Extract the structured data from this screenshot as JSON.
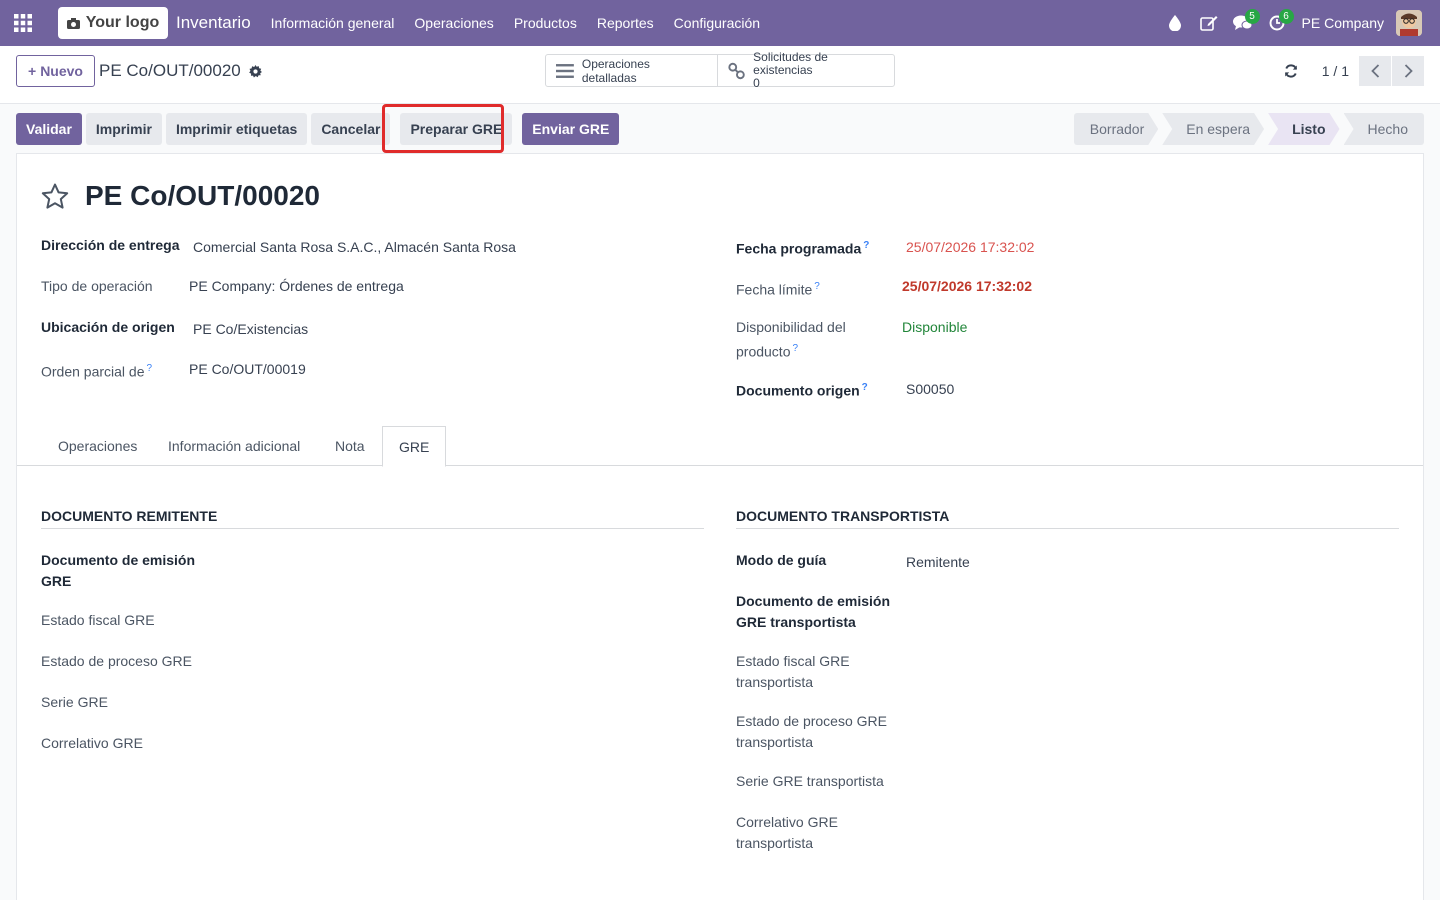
{
  "navbar": {
    "logo_text": "Your logo",
    "app_name": "Inventario",
    "menu": [
      "Información general",
      "Operaciones",
      "Productos",
      "Reportes",
      "Configuración"
    ],
    "messages_badge": "5",
    "activities_badge": "6",
    "company": "PE Company"
  },
  "control": {
    "new_label": "Nuevo",
    "record_name": "PE Co/OUT/00020",
    "smart_buttons": {
      "detailed_ops": "Operaciones detalladas",
      "stock_requests_label": "Solicitudes de existencias",
      "stock_requests_count": "0"
    },
    "pager": "1 / 1"
  },
  "actions": {
    "validate": "Validar",
    "print": "Imprimir",
    "print_labels": "Imprimir etiquetas",
    "cancel": "Cancelar",
    "prepare_gre": "Preparar GRE",
    "send_gre": "Enviar GRE"
  },
  "stages": [
    "Borrador",
    "En espera",
    "Listo",
    "Hecho"
  ],
  "active_stage": "Listo",
  "form": {
    "title": "PE Co/OUT/00020",
    "delivery_address_label": "Dirección de entrega",
    "delivery_address": "Comercial Santa Rosa S.A.C., Almacén Santa Rosa",
    "operation_type_label": "Tipo de operación",
    "operation_type": "PE Company: Órdenes de entrega",
    "source_location_label": "Ubicación de origen",
    "source_location": "PE Co/Existencias",
    "backorder_label": "Orden parcial de",
    "backorder": "PE Co/OUT/00019",
    "scheduled_date_label": "Fecha programada",
    "scheduled_date": "25/07/2026 17:32:02",
    "deadline_label": "Fecha límite",
    "deadline": "25/07/2026 17:32:02",
    "availability_label_1": "Disponibilidad del",
    "availability_label_2": "producto",
    "availability": "Disponible",
    "source_doc_label": "Documento origen",
    "source_doc": "S00050"
  },
  "tabs": [
    "Operaciones",
    "Información adicional",
    "Nota",
    "GRE"
  ],
  "active_tab": "GRE",
  "gre": {
    "sender_title": "DOCUMENTO REMITENTE",
    "sender_fields": {
      "doc_emision_1": "Documento de emisión",
      "doc_emision_2": "GRE",
      "estado_fiscal": "Estado fiscal GRE",
      "estado_proceso": "Estado de proceso GRE",
      "serie": "Serie GRE",
      "correlativo": "Correlativo GRE"
    },
    "carrier_title": "DOCUMENTO TRANSPORTISTA",
    "carrier_fields": {
      "modo_guia_label": "Modo de guía",
      "modo_guia": "Remitente",
      "doc_emision_1": "Documento de emisión",
      "doc_emision_2": "GRE transportista",
      "estado_fiscal_1": "Estado fiscal GRE",
      "estado_fiscal_2": "transportista",
      "estado_proceso_1": "Estado de proceso GRE",
      "estado_proceso_2": "transportista",
      "serie": "Serie GRE transportista",
      "correlativo_1": "Correlativo GRE",
      "correlativo_2": "transportista"
    }
  },
  "colors": {
    "brand": "#71639e",
    "highlight": "#e02b2b",
    "deadline": "#c0392b",
    "available": "#22863a"
  }
}
